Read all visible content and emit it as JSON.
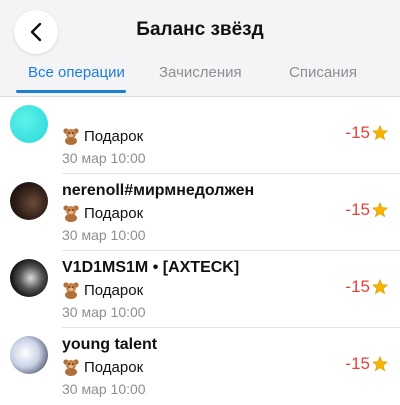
{
  "header": {
    "title": "Баланс звёзд",
    "back_icon": "chevron-left-icon"
  },
  "tabs": [
    {
      "label": "Все операции",
      "active": true
    },
    {
      "label": "Зачисления",
      "active": false
    },
    {
      "label": "Списания",
      "active": false
    }
  ],
  "colors": {
    "accent": "#1c7fd6",
    "negative": "#e8413a",
    "star": "#f4b400"
  },
  "transactions": [
    {
      "name": "",
      "avatar": "cyan-avatar",
      "item": "Подарок",
      "item_icon": "teddy-bear-icon",
      "date": "30 мар 10:00",
      "amount": "-15",
      "currency_icon": "star-icon"
    },
    {
      "name": "nerenoll#мирмнедолжен",
      "avatar": "photo-avatar",
      "item": "Подарок",
      "item_icon": "teddy-bear-icon",
      "date": "30 мар 10:00",
      "amount": "-15",
      "currency_icon": "star-icon"
    },
    {
      "name": "V1D1MS1M • [AXTECK]",
      "avatar": "photo-avatar",
      "item": "Подарок",
      "item_icon": "teddy-bear-icon",
      "date": "30 мар 10:00",
      "amount": "-15",
      "currency_icon": "star-icon"
    },
    {
      "name": "young talent",
      "avatar": "photo-avatar",
      "item": "Подарок",
      "item_icon": "teddy-bear-icon",
      "date": "30 мар 10:00",
      "amount": "-15",
      "currency_icon": "star-icon"
    }
  ]
}
